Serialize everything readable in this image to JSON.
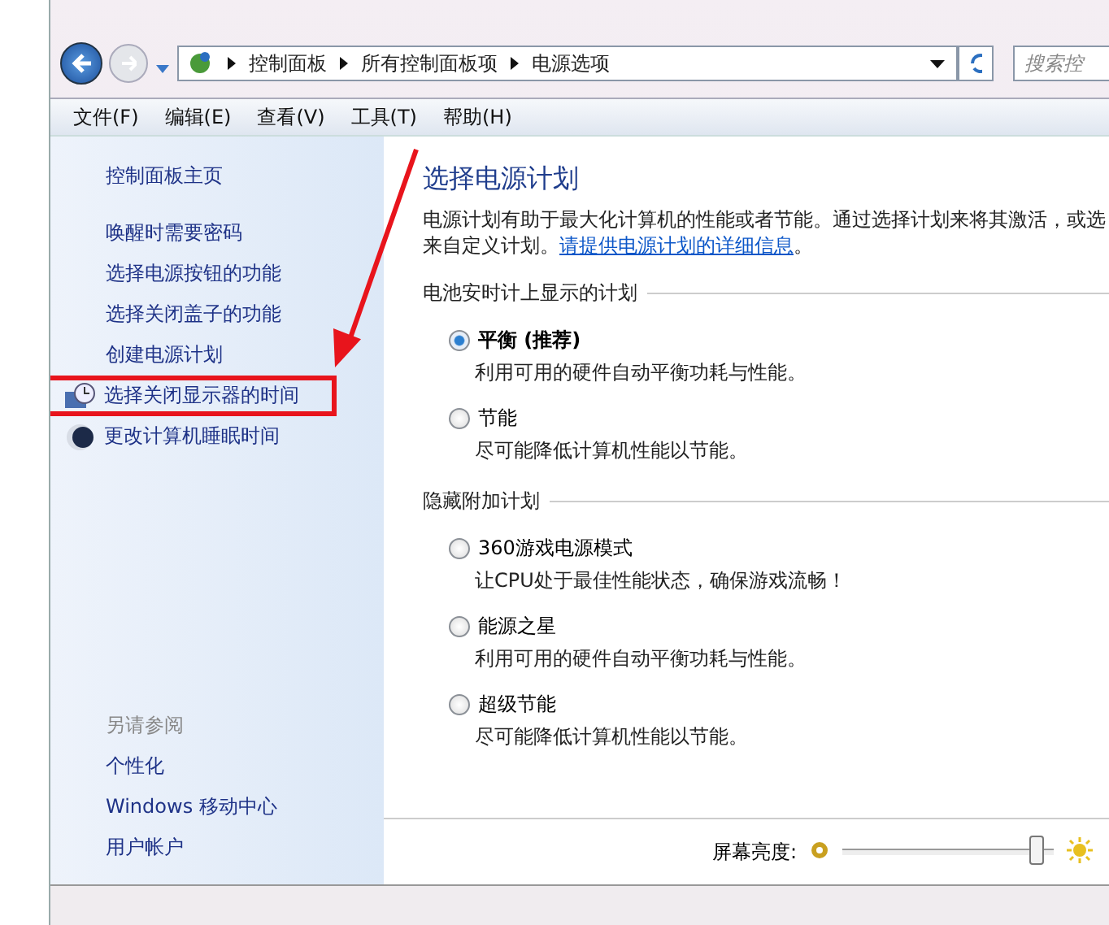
{
  "address_bar": {
    "breadcrumbs": [
      "控制面板",
      "所有控制面板项",
      "电源选项"
    ],
    "search": {
      "placeholder": "搜索控"
    }
  },
  "menu": [
    "文件(F)",
    "编辑(E)",
    "查看(V)",
    "工具(T)",
    "帮助(H)"
  ],
  "sidebar": {
    "home": "控制面板主页",
    "items": [
      {
        "label": "唤醒时需要密码",
        "kind": "link"
      },
      {
        "label": "选择电源按钮的功能",
        "kind": "link"
      },
      {
        "label": "选择关闭盖子的功能",
        "kind": "link"
      },
      {
        "label": "创建电源计划",
        "kind": "link"
      },
      {
        "label": "选择关闭显示器的时间",
        "kind": "monitor"
      },
      {
        "label": "更改计算机睡眠时间",
        "kind": "moon"
      }
    ],
    "see_also": {
      "title": "另请参阅",
      "items": [
        "个性化",
        "Windows 移动中心",
        "用户帐户"
      ]
    }
  },
  "main": {
    "title": "选择电源计划",
    "description": "电源计划有助于最大化计算机的性能或者节能。通过选择计划来将其激活，或选",
    "description_2": "来自定义计划。",
    "link": "请提供电源计划的详细信息",
    "link_end": "。",
    "groups": [
      {
        "title": "电池安时计上显示的计划",
        "plans": [
          {
            "name": "平衡 (推荐)",
            "description": "利用可用的硬件自动平衡功耗与性能。",
            "selected": true
          },
          {
            "name": "节能",
            "description": "尽可能降低计算机性能以节能。",
            "selected": false
          }
        ]
      },
      {
        "title": "隐藏附加计划",
        "plans": [
          {
            "name": "360游戏电源模式",
            "description": "让CPU处于最佳性能状态，确保游戏流畅！",
            "selected": false
          },
          {
            "name": "能源之星",
            "description": "利用可用的硬件自动平衡功耗与性能。",
            "selected": false
          },
          {
            "name": "超级节能",
            "description": "尽可能降低计算机性能以节能。",
            "selected": false
          }
        ]
      }
    ]
  },
  "brightness": {
    "label": "屏幕亮度:",
    "level": 0.95
  }
}
